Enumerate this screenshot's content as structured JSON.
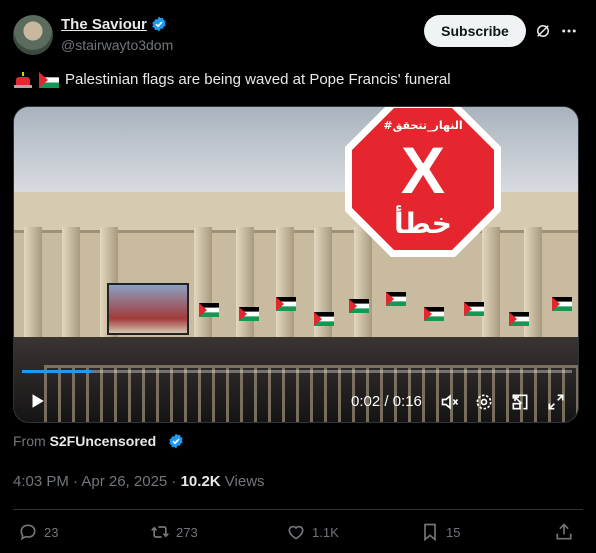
{
  "author": {
    "name": "The Saviour",
    "handle": "@stairwayto3dom"
  },
  "subscribe_label": "Subscribe",
  "post": {
    "text": "Palestinian flags are being waved at Pope Francis' funeral"
  },
  "video": {
    "time_label": "0:02 / 0:16",
    "progress": 0.125,
    "overlay": {
      "banner_text": "#النهار_تتحقق",
      "mark": "X",
      "label": "خطأ"
    }
  },
  "source": {
    "from_label": "From",
    "name": "S2FUncensored"
  },
  "meta": {
    "time": "4:03 PM · Apr 26, 2025 · ",
    "views_count": "10.2K",
    "views_label": " Views"
  },
  "actions": {
    "replies": "23",
    "reposts": "273",
    "likes": "1.1K",
    "bookmarks": "15"
  },
  "colors": {
    "accent": "#1d9bf0",
    "stop_red": "#e5262e"
  }
}
